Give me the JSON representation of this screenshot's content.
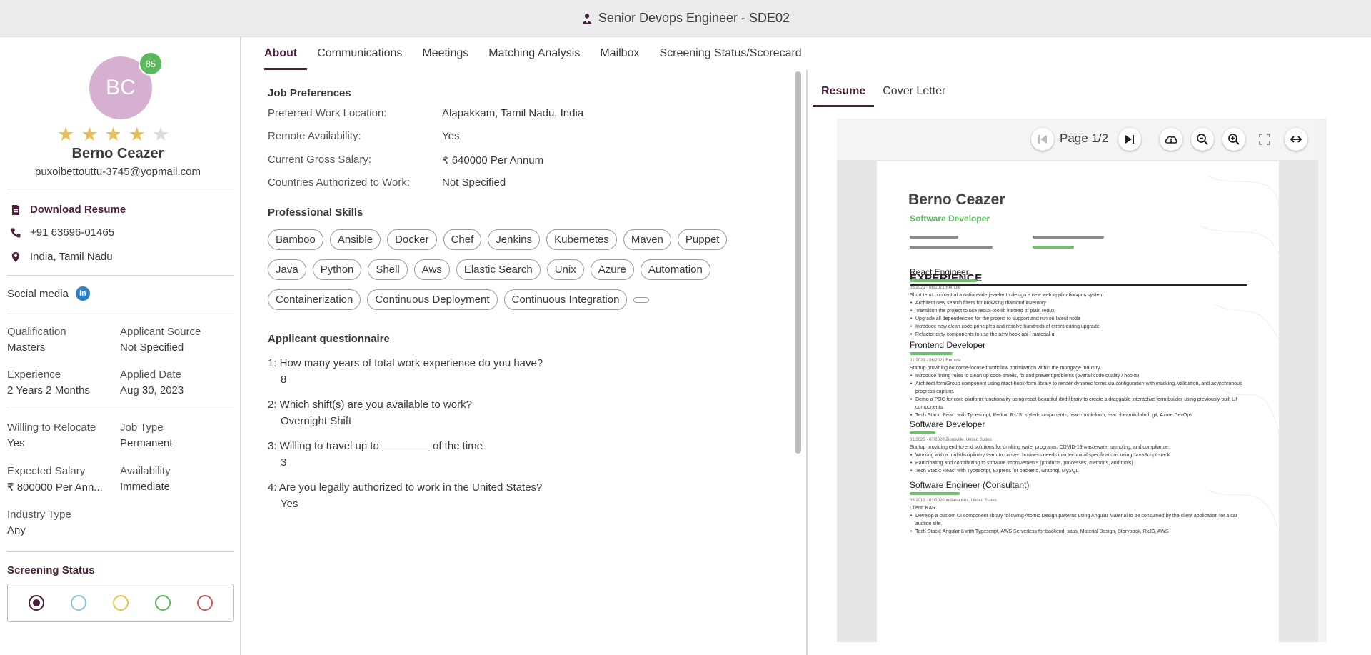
{
  "window": {
    "title": "Senior Devops Engineer - SDE02"
  },
  "candidate": {
    "initials": "BC",
    "score": "85",
    "rating": 4,
    "rating_max": 5,
    "name": "Berno Ceazer",
    "email": "puxoibettouttu-3745@yopmail.com",
    "download_label": "Download Resume",
    "phone": "+91 63696-01465",
    "location": "India, Tamil Nadu",
    "social_label": "Social media",
    "social_icon_text": "in"
  },
  "details": {
    "qualification": {
      "label": "Qualification",
      "value": "Masters"
    },
    "source": {
      "label": "Applicant Source",
      "value": "Not Specified"
    },
    "experience": {
      "label": "Experience",
      "value": "2 Years 2 Months"
    },
    "applied": {
      "label": "Applied Date",
      "value": "Aug 30, 2023"
    },
    "relocate": {
      "label": "Willing to Relocate",
      "value": "Yes"
    },
    "job_type": {
      "label": "Job Type",
      "value": "Permanent"
    },
    "salary": {
      "label": "Expected Salary",
      "value": "₹ 800000 Per Ann..."
    },
    "availability": {
      "label": "Availability",
      "value": "Immediate"
    },
    "industry": {
      "label": "Industry Type",
      "value": "Any"
    }
  },
  "screening": {
    "title": "Screening Status",
    "options": [
      {
        "color": "#4a1e3a",
        "selected": true
      },
      {
        "color": "#8cc2dc",
        "selected": false
      },
      {
        "color": "#e8c547",
        "selected": false
      },
      {
        "color": "#5cb85c",
        "selected": false
      },
      {
        "color": "#d05a5a",
        "selected": false
      }
    ]
  },
  "tabs": [
    "About",
    "Communications",
    "Meetings",
    "Matching Analysis",
    "Mailbox",
    "Screening Status/Scorecard"
  ],
  "active_tab": "About",
  "job_preferences": {
    "title": "Job Preferences",
    "rows": [
      {
        "label": "Preferred Work Location:",
        "value": "Alapakkam, Tamil Nadu, India"
      },
      {
        "label": "Remote Availability:",
        "value": "Yes"
      },
      {
        "label": "Current Gross Salary:",
        "value": "₹ 640000 Per Annum"
      },
      {
        "label": "Countries Authorized to Work:",
        "value": "Not Specified"
      }
    ]
  },
  "skills": {
    "title": "Professional Skills",
    "items": [
      "Bamboo",
      "Ansible",
      "Docker",
      "Chef",
      "Jenkins",
      "Kubernetes",
      "Maven",
      "Puppet",
      "Java",
      "Python",
      "Shell",
      "Aws",
      "Elastic Search",
      "Unix",
      "Azure",
      "Automation",
      "Containerization",
      "Continuous Deployment",
      "Continuous Integration"
    ]
  },
  "questionnaire": {
    "title": "Applicant questionnaire",
    "items": [
      {
        "q": "1: How many years of total work experience do you have?",
        "a": "8"
      },
      {
        "q": "2: Which shift(s) are you available to work?",
        "a": "Overnight Shift"
      },
      {
        "q": "3: Willing to travel up to ________ of the time",
        "a": "3"
      },
      {
        "q": "4: Are you legally authorized to work in the United States?",
        "a": "Yes"
      }
    ]
  },
  "right_tabs": [
    "Resume",
    "Cover Letter"
  ],
  "viewer": {
    "page_label": "Page 1/2"
  },
  "resume": {
    "name": "Berno Ceazer",
    "role": "Software Developer",
    "section": "EXPERIENCE",
    "jobs": [
      {
        "title": "React Engineer",
        "meta": "06/2021 - 08/2021    Remote",
        "lines": [
          "Short term contract at a nationwide jeweler to design a new web application/pos system."
        ],
        "bullets": [
          "Architect new search filters for browsing diamond inventory",
          "Transition the project to use redux-toolkit instead of plain redux",
          "Upgrade all dependencies for the project to support and run on latest node",
          "Introduce new clean code principles and resolve hundreds of errors during upgrade",
          "Refactor dirty components to use the new hook api / material-ui"
        ]
      },
      {
        "title": "Frontend Developer",
        "meta": "01/2021 - 06/2021    Remote",
        "lines": [
          "Startup providing outcome-focused workflow optimization within the mortgage industry."
        ],
        "bullets": [
          "Introduce linting rules to clean up code smells, fix and prevent problems (overall code quality / hooks)",
          "Architect formGroup component using react-hook-form library to render dynamic forms via configuration with masking, validation, and asynchronous progress capture.",
          "Demo a POC for core platform functionality using react-beautiful-dnd library to create a draggable interactive form builder using previously built UI components.",
          "Tech Stack: React with Typescript, Redux, RxJS, styled-components, react-hook-form, react-beautiful-dnd, git, Azure DevOps"
        ]
      },
      {
        "title": "Software Developer",
        "meta": "01/2020 - 07/2020    Zionsville, United States",
        "lines": [
          "Startup providing end-to-end solutions for drinking water programs, COVID-19 wastewater sampling, and compliance."
        ],
        "bullets": [
          "Working with a multidisciplinary team to convert business needs into technical specifications using JavaScript stack.",
          "Participating and contributing to software improvements (products, processes, methods, and tools)",
          "Tech Stack: React with Typescript, Express for backend, Graphql, MySQL"
        ]
      },
      {
        "title": "Software Engineer (Consultant)",
        "meta": "08/2019 - 01/2020    Indianapolis, United States",
        "lines": [
          "Client: KAR"
        ],
        "bullets": [
          "Develop a custom UI component library following Atomic Design patterns using Angular Material to be consumed by the client application for a car auction site.",
          "Tech Stack: Angular 8 with Typescript, AWS Serverless for backend, sass, Material Design, Storybook, RxJS, AWS"
        ]
      }
    ]
  }
}
